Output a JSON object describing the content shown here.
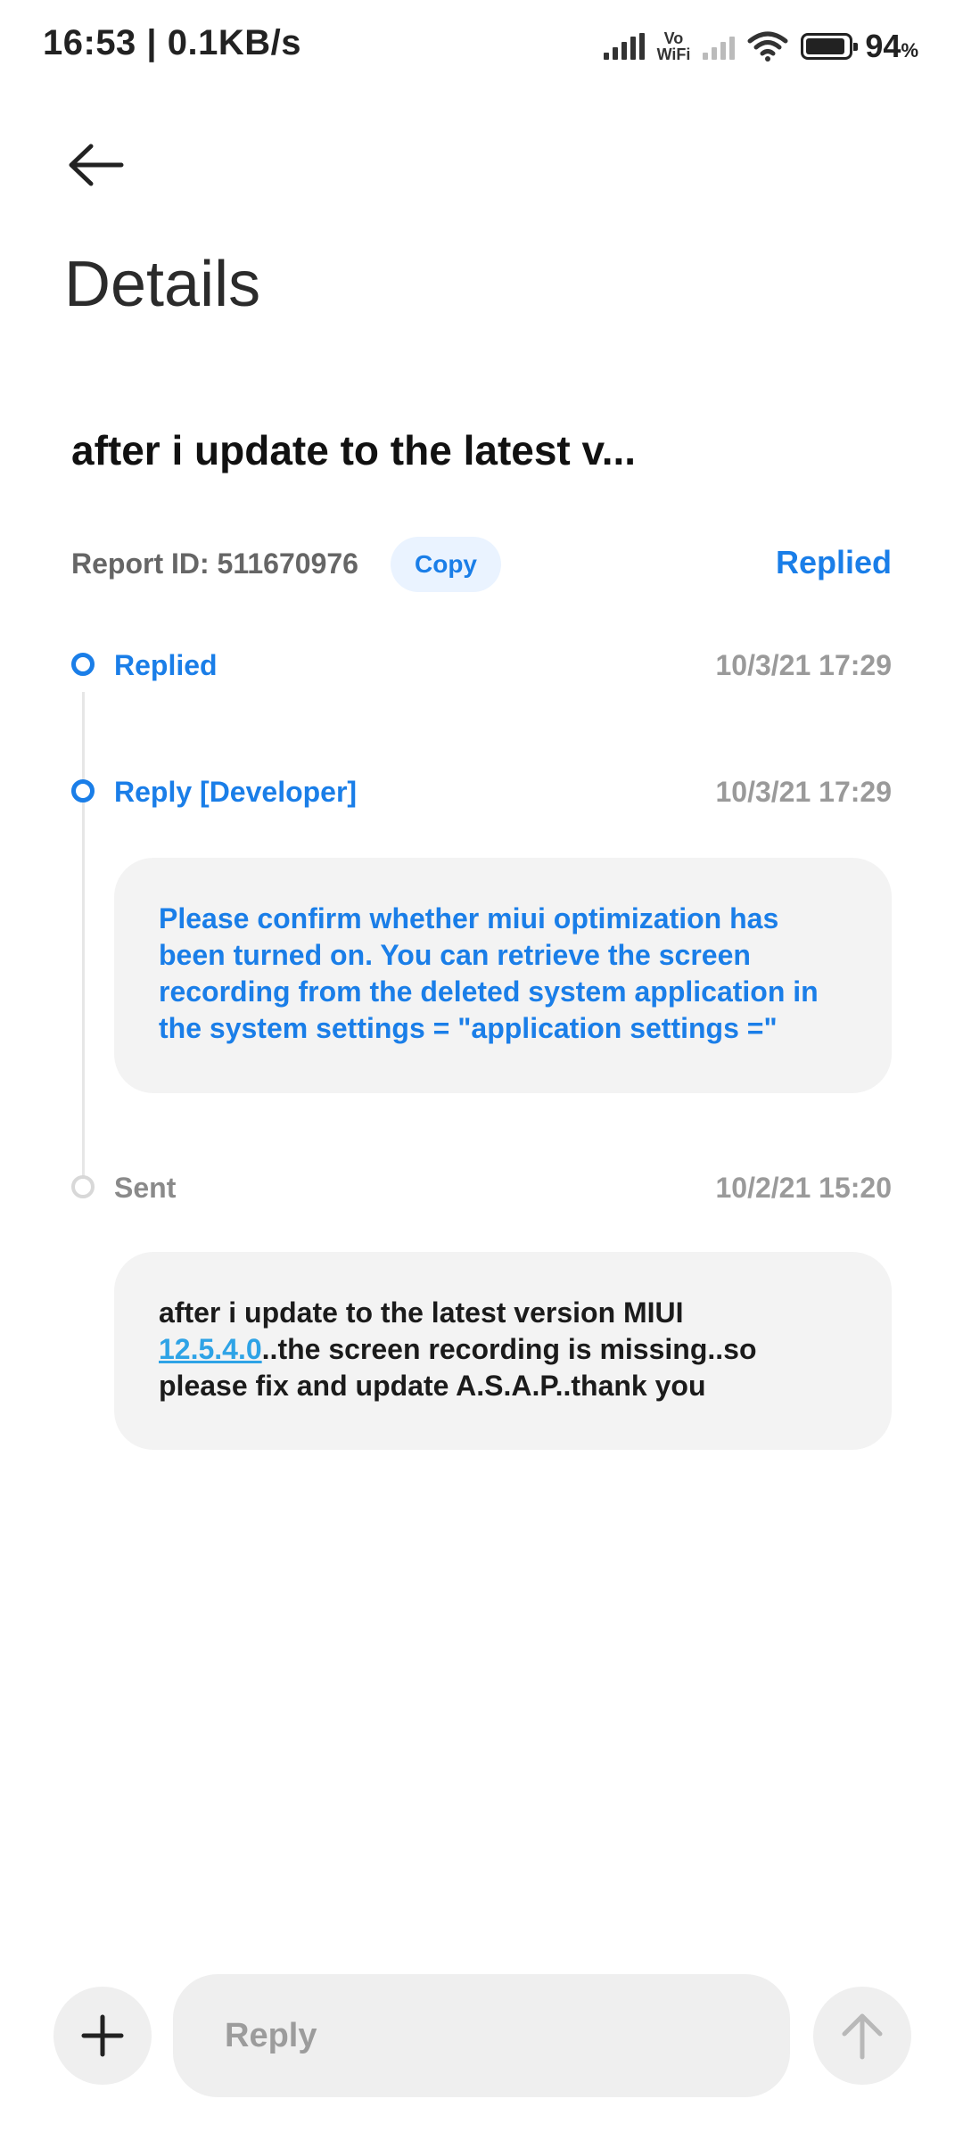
{
  "status_bar": {
    "time": "16:53 | 0.1KB/s",
    "vowifi_top": "Vo",
    "vowifi_bottom": "WiFi",
    "battery_value": "94",
    "battery_unit": "%",
    "battery_level": 0.94
  },
  "header": {
    "title": "Details",
    "back_icon": "arrow-left-icon"
  },
  "report": {
    "title": "after i update to the latest v...",
    "id_label": "Report ID: 511670976",
    "copy_label": "Copy",
    "status": "Replied"
  },
  "timeline": [
    {
      "label": "Replied",
      "time": "10/3/21 17:29"
    },
    {
      "label": "Reply [Developer]",
      "time": "10/3/21 17:29",
      "message": "Please confirm whether miui optimization has been turned on. You can retrieve the screen recording from the deleted system application in the system settings = \"application settings =\""
    },
    {
      "label": "Sent",
      "time": "10/2/21 15:20",
      "message_before": "after i update to the latest version MIUI ",
      "message_link": "12.5.4.0",
      "message_after": "..the screen recording is missing..so please fix and update A.S.A.P..thank you"
    }
  ],
  "composer": {
    "placeholder": "Reply",
    "add_icon": "plus-icon",
    "send_icon": "arrow-up-icon"
  },
  "colors": {
    "accent": "#1a7ee8",
    "link": "#2ea3e6",
    "bubble_bg": "#f3f3f3",
    "muted": "#9a9a9a"
  }
}
